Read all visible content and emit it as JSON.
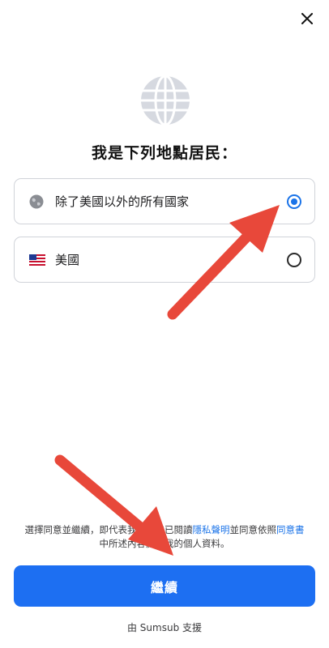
{
  "header": {
    "close_icon": "close-icon"
  },
  "hero": {
    "icon": "globe-icon",
    "title": "我是下列地點居民："
  },
  "options": [
    {
      "label": "除了美國以外的所有國家",
      "icon": "globe-small-icon",
      "selected": true
    },
    {
      "label": "美國",
      "icon": "us-flag-icon",
      "selected": false
    }
  ],
  "consent": {
    "prefix": "選擇同意並繼續，即代表我同意我已閱讀",
    "privacy_link": "隱私聲明",
    "middle": "並同意依照",
    "agreement_link": "同意書",
    "suffix": "中所述內容處理我的個人資料。"
  },
  "continue_button": "繼續",
  "powered_by": "由 Sumsub 支援",
  "colors": {
    "accent": "#1d6ff2",
    "annotation_arrow": "#e8483a"
  }
}
